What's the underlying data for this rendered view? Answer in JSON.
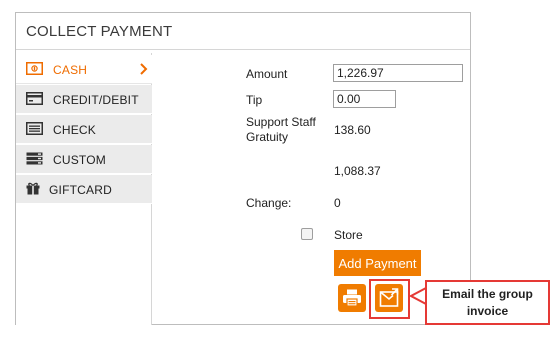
{
  "panel": {
    "title": "COLLECT PAYMENT"
  },
  "sidebar": {
    "items": [
      {
        "label": "CASH",
        "icon": "cash-icon",
        "active": true
      },
      {
        "label": "CREDIT/DEBIT",
        "icon": "credit-card-icon"
      },
      {
        "label": "CHECK",
        "icon": "check-icon"
      },
      {
        "label": "CUSTOM",
        "icon": "custom-icon"
      },
      {
        "label": "GIFTCARD",
        "icon": "gift-icon"
      }
    ]
  },
  "form": {
    "amount_label": "Amount",
    "amount_value": "1,226.97",
    "tip_label": "Tip",
    "tip_value": "0.00",
    "gratuity_label_line1": "Support Staff",
    "gratuity_label_line2": "Gratuity",
    "gratuity_value": "138.60",
    "subtotal_value": "1,088.37",
    "change_label": "Change:",
    "change_value": "0",
    "store_label": "Store",
    "add_payment_label": "Add Payment"
  },
  "actions": {
    "print_icon": "printer-icon",
    "email_icon": "email-invoice-icon"
  },
  "annotation": {
    "callout_text": "Email the group invoice"
  },
  "colors": {
    "accent": "#f07c00",
    "highlight": "#e53935",
    "sidebar_bg": "#ebebeb"
  }
}
